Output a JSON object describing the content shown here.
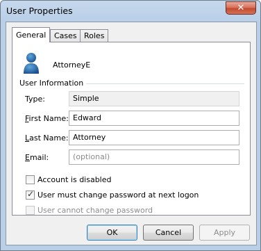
{
  "window": {
    "title": "User Properties",
    "close_glyph": "✕"
  },
  "tabs": [
    {
      "label": "General",
      "active": true
    },
    {
      "label": "Cases",
      "active": false
    },
    {
      "label": "Roles",
      "active": false
    }
  ],
  "general": {
    "username": "AttorneyE",
    "user_icon": "user-icon",
    "group_title": "User Information",
    "fields": {
      "type": {
        "label": "Type:",
        "value": "Simple"
      },
      "first_name": {
        "label_accel": "F",
        "label_rest": "irst Name:",
        "value": "Edward"
      },
      "last_name": {
        "label_accel": "L",
        "label_rest": "ast Name:",
        "value": "Attorney"
      },
      "email": {
        "label_accel": "E",
        "label_rest": "mail:",
        "value": "",
        "placeholder": "(optional)"
      }
    },
    "checkboxes": [
      {
        "label": "Account is disabled",
        "checked": false,
        "enabled": true
      },
      {
        "label": "User must change password at next logon",
        "checked": true,
        "enabled": true
      },
      {
        "label": "User cannot change password",
        "checked": false,
        "enabled": false
      }
    ]
  },
  "buttons": {
    "ok": "OK",
    "cancel": "Cancel",
    "apply": "Apply"
  },
  "colors": {
    "title_bar": "#b9cfe8",
    "close_button": "#c24a2f",
    "default_button_border": "#3c7fb1"
  }
}
